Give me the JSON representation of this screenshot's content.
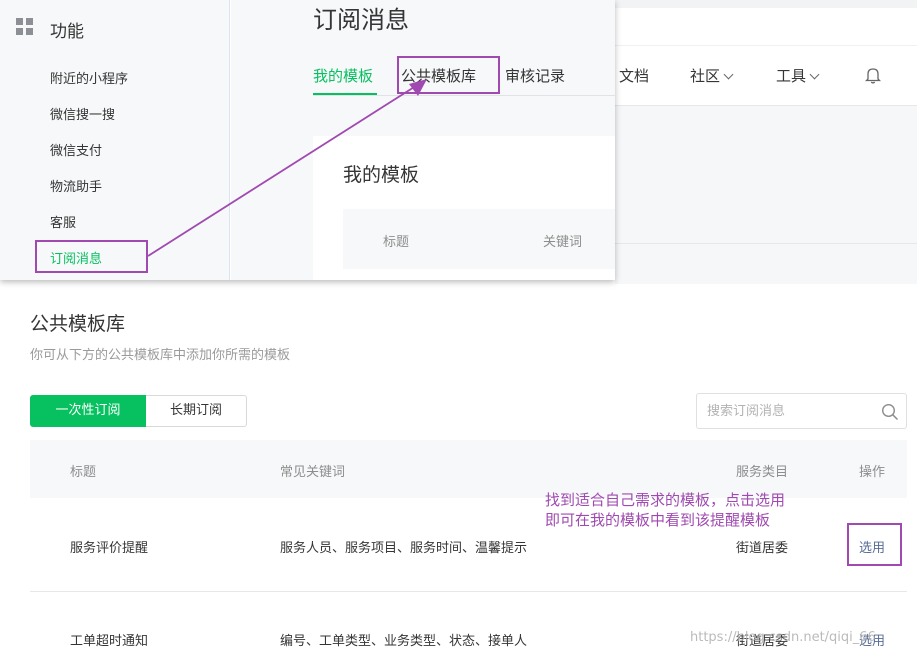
{
  "overlay": {
    "left_title": "功能",
    "menu": [
      {
        "label": "附近的小程序"
      },
      {
        "label": "微信搜一搜"
      },
      {
        "label": "微信支付"
      },
      {
        "label": "物流助手"
      },
      {
        "label": "客服"
      },
      {
        "label": "订阅消息",
        "active": true
      }
    ],
    "heading": "订阅消息",
    "tabs": [
      {
        "label": "我的模板",
        "active": true
      },
      {
        "label": "公共模板库"
      },
      {
        "label": "审核记录"
      }
    ],
    "card_title": "我的模板",
    "card_columns": [
      "标题",
      "关键词"
    ]
  },
  "background_nav": [
    {
      "label": "文档"
    },
    {
      "label": "社区"
    },
    {
      "label": "工具"
    }
  ],
  "public_library": {
    "title": "公共模板库",
    "subtitle": "你可从下方的公共模板库中添加你所需的模板",
    "toggle": {
      "one_time": "一次性订阅",
      "long_term": "长期订阅"
    },
    "search_placeholder": "搜索订阅消息",
    "columns": {
      "title": "标题",
      "keywords": "常见关键词",
      "category": "服务类目",
      "action": "操作"
    },
    "rows": [
      {
        "title": "服务评价提醒",
        "keywords": "服务人员、服务项目、服务时间、温馨提示",
        "category": "街道居委",
        "action": "选用"
      },
      {
        "title": "工单超时通知",
        "keywords": "编号、工单类型、业务类型、状态、接单人",
        "category": "街道居委",
        "action": "选用"
      }
    ]
  },
  "annotation": {
    "line1": "找到适合自己需求的模板，点击选用",
    "line2": "即可在我的模板中看到该提醒模板",
    "color": "#a04ab1"
  },
  "watermark": "https://blog.csdn.net/qiqi_66",
  "colors": {
    "accent": "#07c160",
    "link": "#576b95"
  }
}
